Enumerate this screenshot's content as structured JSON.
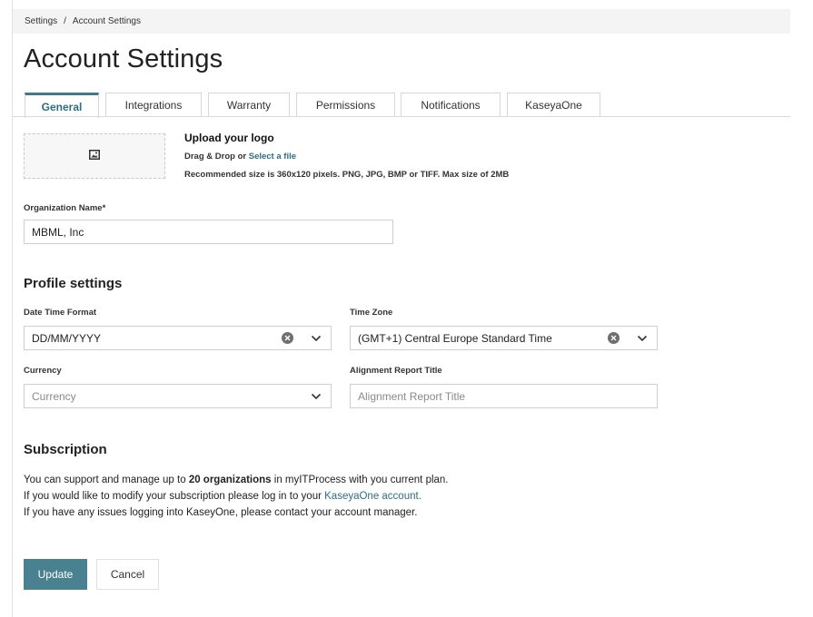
{
  "breadcrumb": {
    "items": [
      "Settings",
      "Account Settings"
    ],
    "separator": "/"
  },
  "page_title": "Account Settings",
  "tabs": [
    {
      "label": "General",
      "active": true
    },
    {
      "label": "Integrations",
      "active": false
    },
    {
      "label": "Warranty",
      "active": false
    },
    {
      "label": "Permissions",
      "active": false
    },
    {
      "label": "Notifications",
      "active": false
    },
    {
      "label": "KaseyaOne",
      "active": false
    }
  ],
  "logo_upload": {
    "icon": "image-icon",
    "title": "Upload your logo",
    "drag_text": "Drag & Drop or",
    "select_link": "Select a file",
    "hint": "Recommended size is 360x120 pixels. PNG, JPG, BMP or TIFF. Max size of 2MB"
  },
  "organization": {
    "label": "Organization Name*",
    "value": "MBML, Inc"
  },
  "profile": {
    "title": "Profile settings",
    "date_format": {
      "label": "Date Time Format",
      "value": "DD/MM/YYYY"
    },
    "time_zone": {
      "label": "Time Zone",
      "value": "(GMT+1) Central Europe Standard Time"
    },
    "currency": {
      "label": "Currency",
      "placeholder": "Currency"
    },
    "alignment_title": {
      "label": "Alignment Report Title",
      "placeholder": "Alignment Report Title"
    }
  },
  "subscription": {
    "title": "Subscription",
    "line1_a": "You can support and manage up to",
    "line1_bold": "20 organizations",
    "line1_b": "in myITProcess with you current plan.",
    "line2_a": "If you would like to modify your subscription please log in to your",
    "line2_link": "KaseyaOne account.",
    "line3": "If you have any issues logging into KaseyOne, please contact your account manager."
  },
  "buttons": {
    "update": "Update",
    "cancel": "Cancel"
  },
  "colors": {
    "accent": "#2e6e80",
    "button_primary": "#4a8190",
    "breadcrumb_bg": "#f4f4f4"
  }
}
